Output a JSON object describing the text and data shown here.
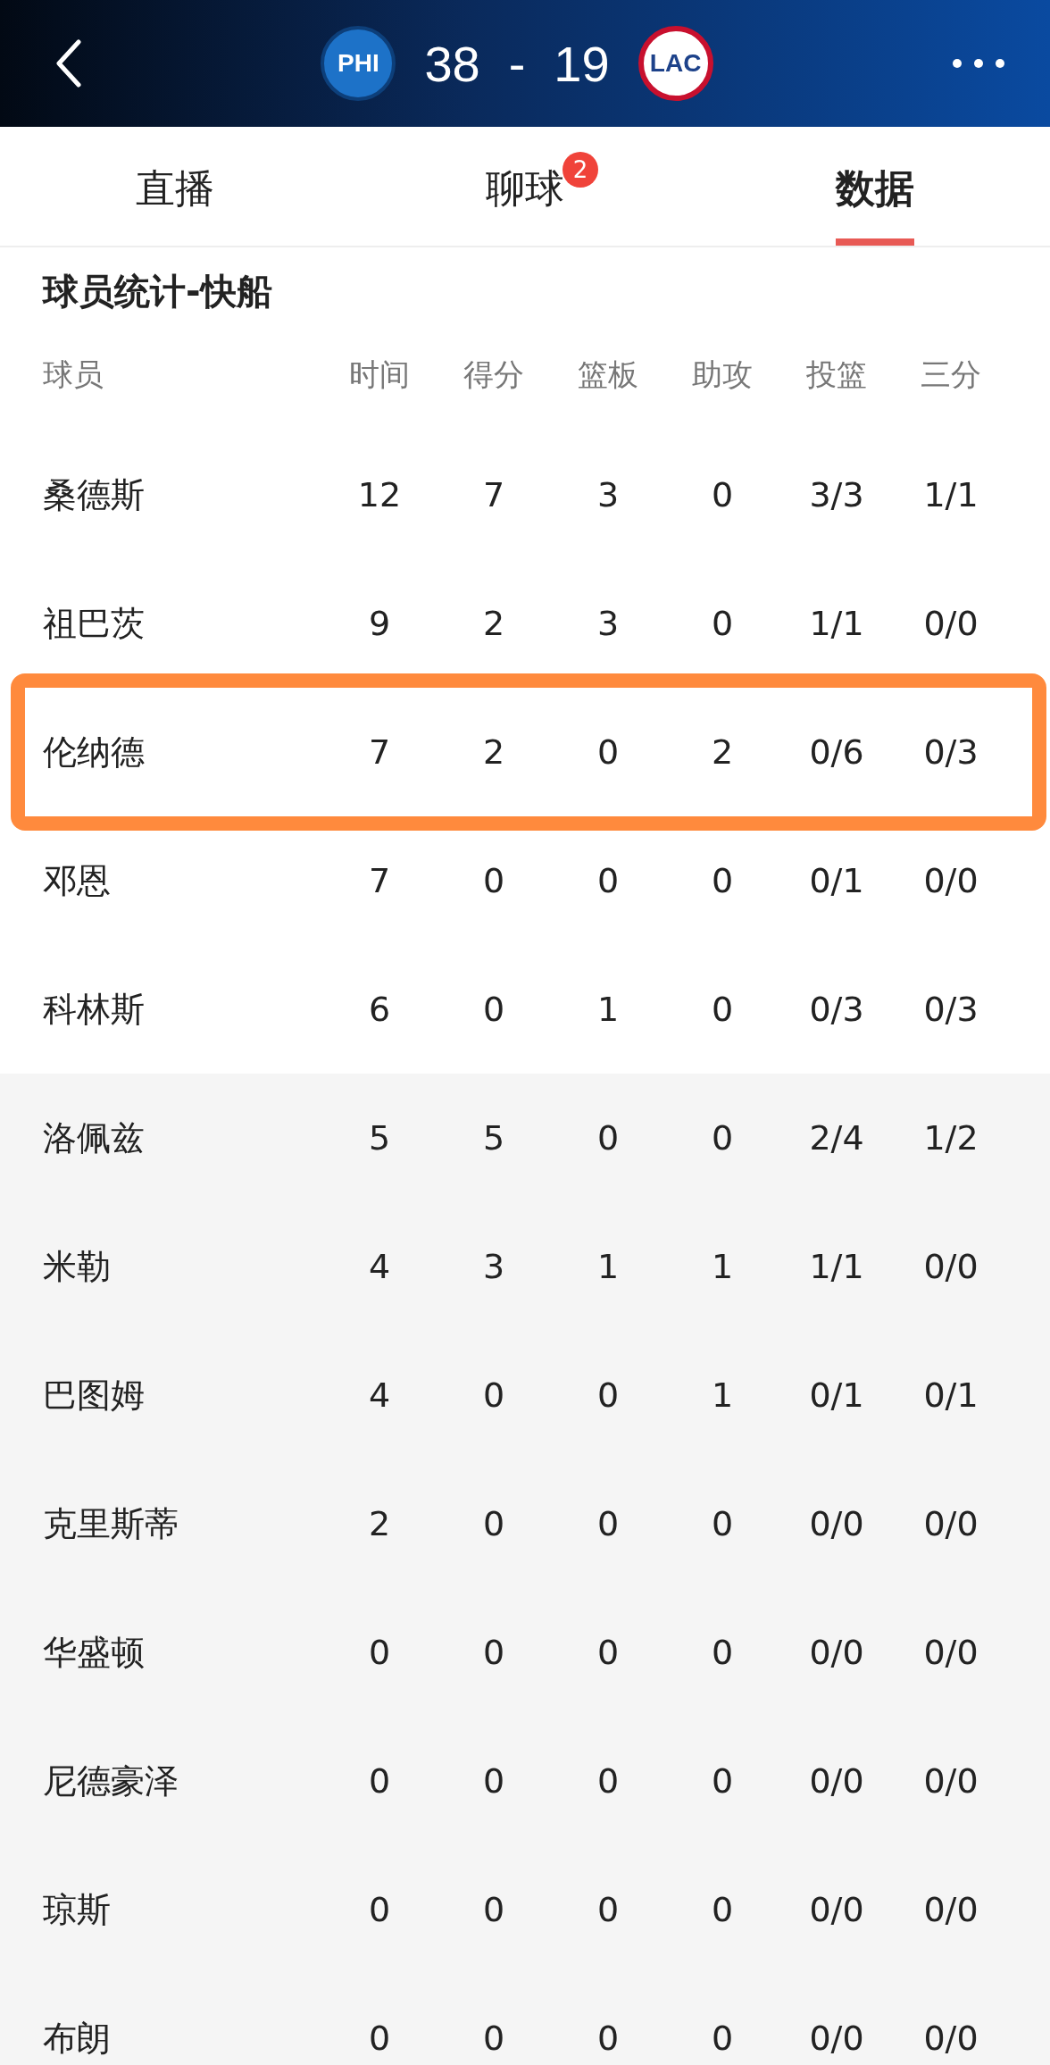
{
  "header": {
    "home": {
      "abbr": "PHI"
    },
    "away": {
      "abbr": "LAC"
    },
    "home_score": "38",
    "separator": "-",
    "away_score": "19"
  },
  "tabs": [
    {
      "label": "直播",
      "selected": false
    },
    {
      "label": "聊球",
      "selected": false,
      "badge": "2"
    },
    {
      "label": "数据",
      "selected": true
    }
  ],
  "section_title": "球员统计-快船",
  "table": {
    "columns": [
      "球员",
      "时间",
      "得分",
      "篮板",
      "助攻",
      "投篮",
      "三分"
    ],
    "rows": [
      {
        "kind": "starter",
        "highlighted": false,
        "cells": [
          "桑德斯",
          "12",
          "7",
          "3",
          "0",
          "3/3",
          "1/1"
        ]
      },
      {
        "kind": "starter",
        "highlighted": false,
        "cells": [
          "祖巴茨",
          "9",
          "2",
          "3",
          "0",
          "1/1",
          "0/0"
        ]
      },
      {
        "kind": "starter",
        "highlighted": true,
        "cells": [
          "伦纳德",
          "7",
          "2",
          "0",
          "2",
          "0/6",
          "0/3"
        ]
      },
      {
        "kind": "starter",
        "highlighted": false,
        "cells": [
          "邓恩",
          "7",
          "0",
          "0",
          "0",
          "0/1",
          "0/0"
        ]
      },
      {
        "kind": "starter",
        "highlighted": false,
        "cells": [
          "科林斯",
          "6",
          "0",
          "1",
          "0",
          "0/3",
          "0/3"
        ]
      },
      {
        "kind": "bench",
        "highlighted": false,
        "cells": [
          "洛佩兹",
          "5",
          "5",
          "0",
          "0",
          "2/4",
          "1/2"
        ]
      },
      {
        "kind": "bench",
        "highlighted": false,
        "cells": [
          "米勒",
          "4",
          "3",
          "1",
          "1",
          "1/1",
          "0/0"
        ]
      },
      {
        "kind": "bench",
        "highlighted": false,
        "cells": [
          "巴图姆",
          "4",
          "0",
          "0",
          "1",
          "0/1",
          "0/1"
        ]
      },
      {
        "kind": "bench",
        "highlighted": false,
        "cells": [
          "克里斯蒂",
          "2",
          "0",
          "0",
          "0",
          "0/0",
          "0/0"
        ]
      },
      {
        "kind": "bench",
        "highlighted": false,
        "cells": [
          "华盛顿",
          "0",
          "0",
          "0",
          "0",
          "0/0",
          "0/0"
        ]
      },
      {
        "kind": "bench",
        "highlighted": false,
        "cells": [
          "尼德豪泽",
          "0",
          "0",
          "0",
          "0",
          "0/0",
          "0/0"
        ]
      },
      {
        "kind": "bench",
        "highlighted": false,
        "cells": [
          "琼斯",
          "0",
          "0",
          "0",
          "0",
          "0/0",
          "0/0"
        ]
      },
      {
        "kind": "bench",
        "highlighted": false,
        "cells": [
          "布朗",
          "0",
          "0",
          "0",
          "0",
          "0/0",
          "0/0"
        ]
      }
    ]
  }
}
